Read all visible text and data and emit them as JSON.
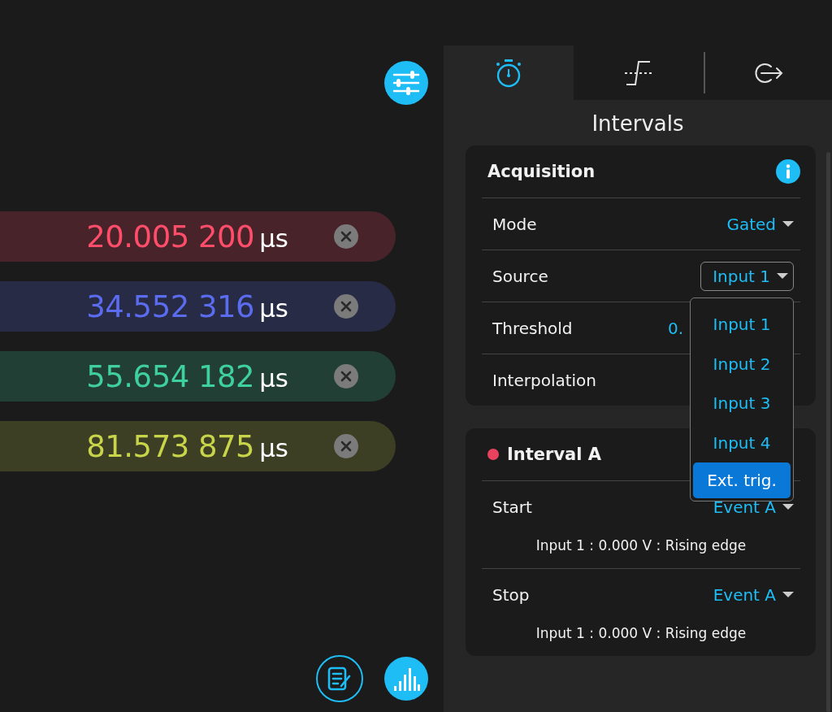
{
  "readouts": [
    {
      "value": "20.005 200",
      "unit": "µs",
      "color": "#ff4d6a"
    },
    {
      "value": "34.552 316",
      "unit": "µs",
      "color": "#5b6cf0"
    },
    {
      "value": "55.654 182",
      "unit": "µs",
      "color": "#3fd0a0"
    },
    {
      "value": "81.573 875",
      "unit": "µs",
      "color": "#c8d44a"
    }
  ],
  "tabs": [
    {
      "kind": "stopwatch",
      "selected": true
    },
    {
      "kind": "trigger",
      "selected": false
    },
    {
      "kind": "export",
      "selected": false
    }
  ],
  "panel_title": "Intervals",
  "acquisition": {
    "title": "Acquisition",
    "rows": [
      {
        "label": "Mode",
        "value": "Gated",
        "kind": "dropdown"
      },
      {
        "label": "Source",
        "value": "Input 1",
        "kind": "select"
      },
      {
        "label": "Threshold",
        "value": "0.",
        "kind": "text"
      },
      {
        "label": "Interpolation"
      }
    ]
  },
  "source_menu": [
    {
      "label": "Input 1",
      "selected": false
    },
    {
      "label": "Input 2",
      "selected": false
    },
    {
      "label": "Input 3",
      "selected": false
    },
    {
      "label": "Input 4",
      "selected": false
    },
    {
      "label": "Ext. trig.",
      "selected": true
    }
  ],
  "interval": {
    "title": "Interval A",
    "color": "#e8435e",
    "rows": [
      {
        "label": "Start",
        "value": "Event A",
        "detail": "Input 1 : 0.000 V : Rising edge"
      },
      {
        "label": "Stop",
        "value": "Event A",
        "detail": "Input 1 : 0.000 V : Rising edge"
      }
    ]
  }
}
